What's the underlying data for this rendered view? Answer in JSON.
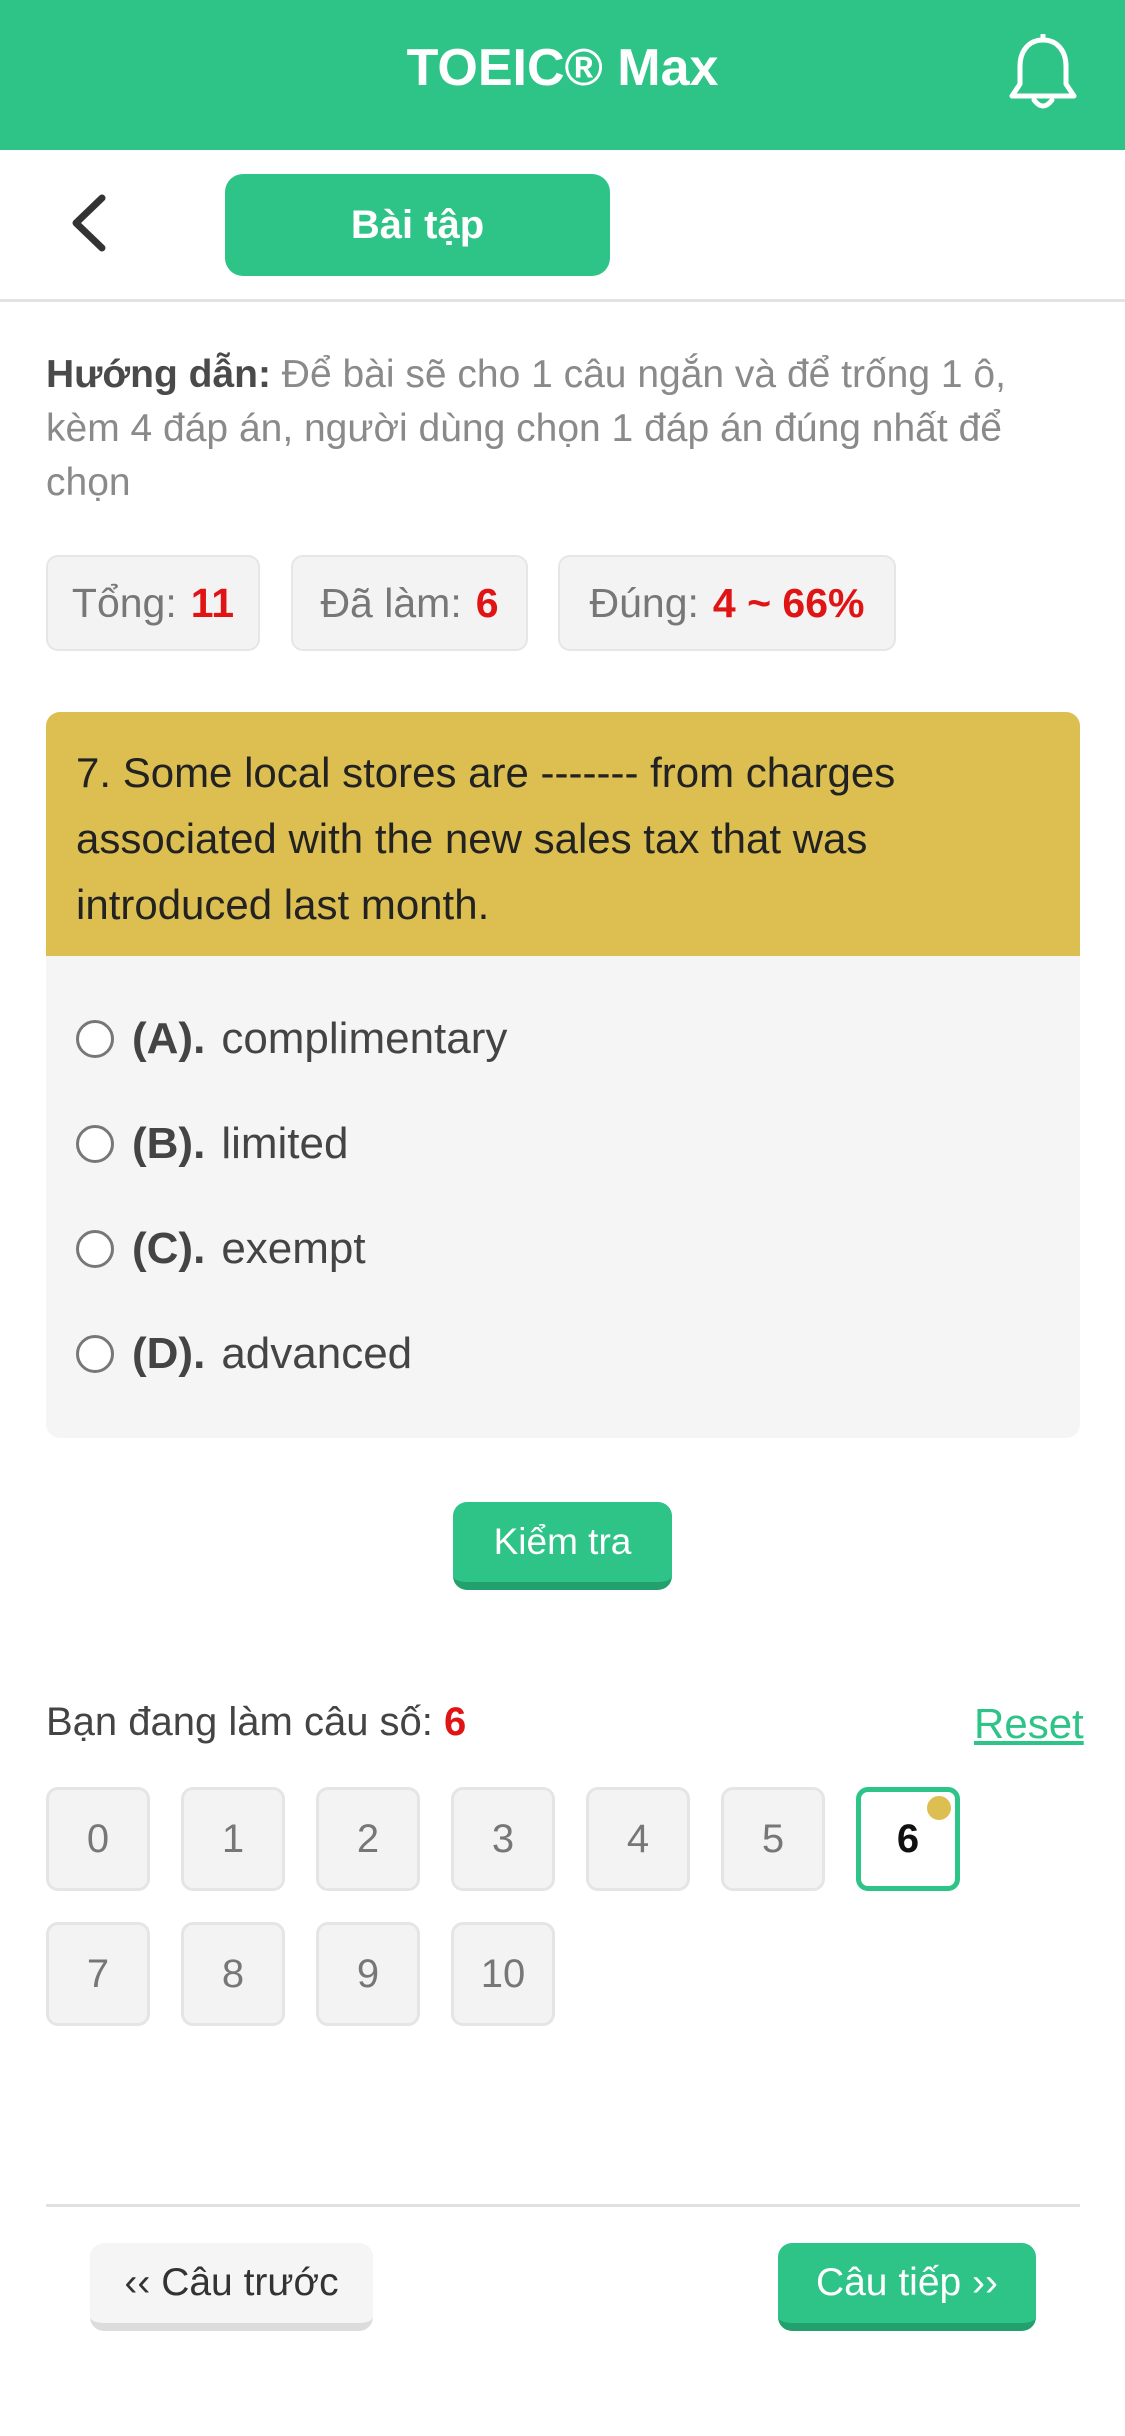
{
  "app": {
    "title": "TOEIC® Max"
  },
  "header": {
    "tab_label": "Bài tập"
  },
  "guide": {
    "label": "Hướng dẫn:",
    "text": "Để bài sẽ cho 1 câu ngắn và để trống 1 ô, kèm 4 đáp án, người dùng chọn 1 đáp án đúng nhất để chọn"
  },
  "stats": [
    {
      "label": "Tổng:",
      "value": "11"
    },
    {
      "label": "Đã làm:",
      "value": "6"
    },
    {
      "label": "Đúng:",
      "value": "4 ~ 66%"
    }
  ],
  "question": {
    "text": "7. Some local stores are ------- from charges associated with the new sales tax that was introduced last month.",
    "options": [
      {
        "letter": "(A).",
        "text": "complimentary"
      },
      {
        "letter": "(B).",
        "text": "limited"
      },
      {
        "letter": "(C).",
        "text": "exempt"
      },
      {
        "letter": "(D).",
        "text": "advanced"
      }
    ]
  },
  "check_label": "Kiểm tra",
  "progress": {
    "label": "Bạn đang làm câu số:",
    "current": "6",
    "reset_label": "Reset"
  },
  "numbers": [
    "0",
    "1",
    "2",
    "3",
    "4",
    "5",
    "6",
    "7",
    "8",
    "9",
    "10"
  ],
  "active_number": "6",
  "nav": {
    "prev_label": "‹‹ Câu trước",
    "next_label": "Câu tiếp ››"
  },
  "colors": {
    "primary": "#2ec487",
    "question_bg": "#dcbf50",
    "accent_red": "#e01414"
  }
}
